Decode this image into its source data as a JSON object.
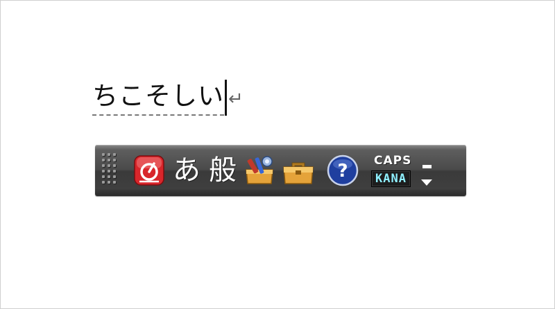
{
  "composition": {
    "text": "ちこそしい",
    "return_mark": "↵"
  },
  "langbar": {
    "ime_icon": "ime-logo-icon",
    "input_mode": "あ",
    "dictionary_mode": "般",
    "toolbox_icon_1": "toolbox-tools-icon",
    "toolbox_icon_2": "toolbox-icon",
    "help_icon": "help-icon",
    "help_glyph": "?",
    "caps_label": "CAPS",
    "kana_label": "KANA",
    "colors": {
      "bar": "#4a4a4a",
      "kana_text": "#8ff0ff",
      "ime_icon_red": "#d8262b",
      "help_blue": "#1f3f9f",
      "toolbox_orange": "#e5a33a"
    }
  }
}
